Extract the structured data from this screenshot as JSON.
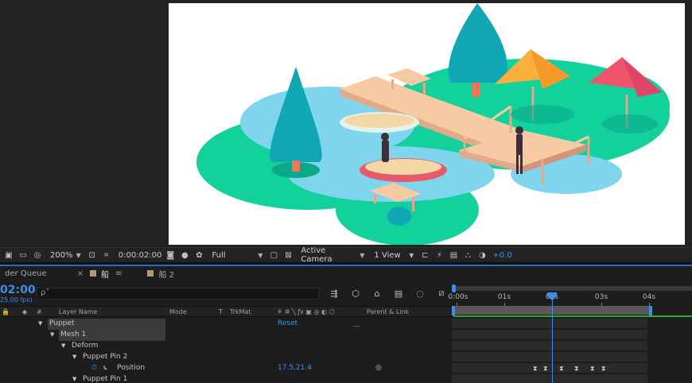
{
  "viewer_bar": {
    "zoom": "200%",
    "timecode": "0:00:02:00",
    "resolution": "Full",
    "camera": "Active Camera",
    "views": "1 View",
    "exposure": "+0.0"
  },
  "tabs": [
    {
      "label": "der Queue"
    },
    {
      "label": "船"
    },
    {
      "label": "船 2"
    }
  ],
  "timeline": {
    "timecode": "02:00",
    "fps": "25.00 fps)",
    "search_placeholder": "ρ˅",
    "ruler_labels": [
      "0:00s",
      "01s",
      "02s",
      "03s",
      "04s"
    ]
  },
  "columns": {
    "layer_name": "Layer Name",
    "mode": "Mode",
    "t": "T",
    "trkmat": "TrkMat",
    "parent": "Parent & Link",
    "hash": "#"
  },
  "layers": {
    "puppet": "Puppet",
    "puppet_value": "Reset",
    "puppet_dash": "__",
    "mesh": "Mesh 1",
    "deform": "Deform",
    "pin2": "Puppet Pin 2",
    "position": "Position",
    "position_value": "17.5,21.4",
    "pin1": "Puppet Pin 1"
  },
  "colors": {
    "accent": "#3d8ee8",
    "green": "#2fa63a",
    "label_swatch": "#b39a78"
  }
}
